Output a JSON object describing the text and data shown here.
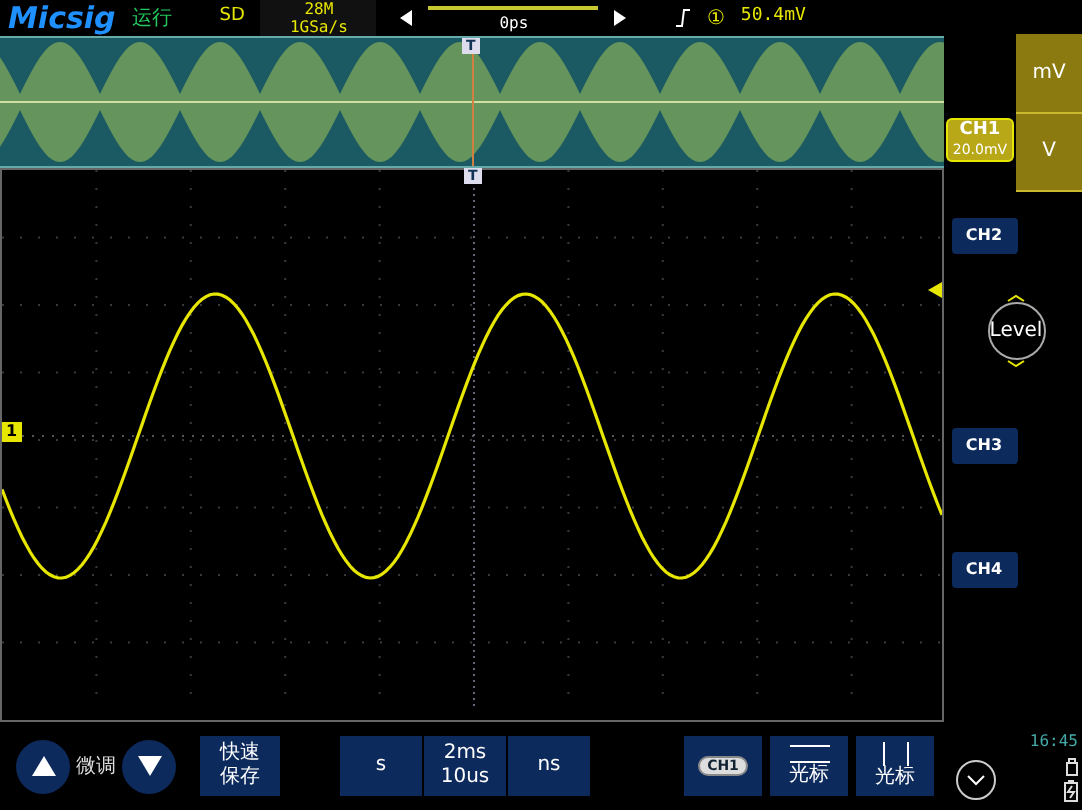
{
  "top_bar": {
    "logo": "Micsig",
    "run_status": "运行",
    "acquire_mode": "SD",
    "memory_depth": "28M",
    "sample_rate": "1GSa/s",
    "horizontal_position": "0ps",
    "trigger": {
      "source": "①",
      "level": "50.4mV"
    }
  },
  "overview": {
    "trigger_marker": "T"
  },
  "main_display": {
    "trigger_marker": "T",
    "channel_marker": "1"
  },
  "channel_tag": {
    "label": "CH1",
    "scale": "20.0mV"
  },
  "units": [
    {
      "label": "mV"
    },
    {
      "label": "V"
    }
  ],
  "channels": [
    {
      "label": "CH2"
    },
    {
      "label": "CH3"
    },
    {
      "label": "CH4"
    }
  ],
  "level_knob": {
    "label": "Level"
  },
  "bottom_bar": {
    "fine_label": "微调",
    "quick_save": [
      "快速",
      "保存"
    ],
    "timebase": [
      {
        "label": "s"
      },
      {
        "lines": [
          "2ms",
          "10us"
        ]
      },
      {
        "label": "ns"
      }
    ],
    "channel_button": "CH1",
    "cursor_buttons": [
      {
        "kind": "horizontal",
        "label": "光标"
      },
      {
        "kind": "vertical",
        "label": "光标"
      }
    ],
    "time": "16:45"
  }
}
